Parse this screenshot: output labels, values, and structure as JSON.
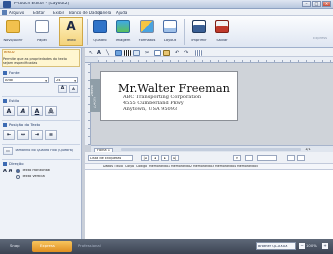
{
  "window": {
    "title": "P-touch Editor - [Layout2]",
    "colors": {
      "accent": "#2f5597",
      "ribbon_selected": "#f4d37b"
    }
  },
  "menu": [
    "Arquivo",
    "Editar",
    "Exibir",
    "Banco de Dados",
    "Janela",
    "Ajuda"
  ],
  "ribbon": {
    "buttons": [
      {
        "label": "Novo/Abrir",
        "icon": "folder-icon"
      },
      {
        "label": "Papel",
        "icon": "paper-icon"
      },
      {
        "label": "Texto",
        "icon": "text-icon"
      },
      {
        "label": "Quadro",
        "icon": "frame-icon"
      },
      {
        "label": "Imagem",
        "icon": "image-icon"
      },
      {
        "label": "Formatos",
        "icon": "shapes-icon"
      },
      {
        "label": "Layout",
        "icon": "layout-icon"
      },
      {
        "label": "Imprimir",
        "icon": "print-icon"
      },
      {
        "label": "Salvar",
        "icon": "save-icon"
      }
    ],
    "selected": "Texto",
    "right_label": "Express"
  },
  "left_pane": {
    "heading": "Texto",
    "hint": "Permite que as propriedades do texto sejam especificadas",
    "font_section": "Fonte",
    "font_value": "Arial",
    "font_size": "24",
    "style_section": "Estilo",
    "style_buttons": [
      "A",
      "A",
      "A",
      "A"
    ],
    "position_section": "Posição do Texto",
    "frame_size_label": "Tamanho do Quadro Fixo (Quebra)",
    "direction_section": "Direção",
    "direction_icon": "A A",
    "direction_options": [
      "Texto Horizontal",
      "Texto Vertical"
    ]
  },
  "label": {
    "side_text": "29mm",
    "side_text2": "2,4cm",
    "name": "Mr.Walter Freeman",
    "line1": "ABC Transporting Corporation",
    "line2": "4555 Cumberland Pkwy",
    "line3": "Anytown, USA 95093"
  },
  "canvas_footer": {
    "page": "Folha 1",
    "counter": "1/1"
  },
  "database": {
    "title": "Lista de Etiquetas",
    "columns": [
      "Dados",
      "Título",
      "Corpo",
      "Código",
      "Memorando1",
      "Memorando2",
      "Memorando3",
      "Memorando4",
      "Memorando5"
    ]
  },
  "status": {
    "tabs": [
      "Snap",
      "Express",
      "Professional"
    ],
    "printer": "Brother QL-XXXX",
    "zoom": "100%"
  }
}
